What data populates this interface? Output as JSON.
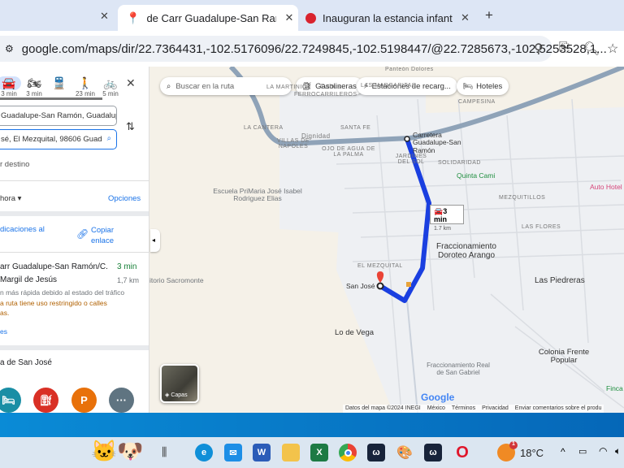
{
  "browser": {
    "tabs": [
      {
        "title": "de Carr Guadalupe-San Ramón"
      },
      {
        "title": "Inauguran la estancia infantil R"
      }
    ],
    "new_tab": "+",
    "url": "google.com/maps/dir/22.7364431,-102.5176096/22.7249845,-102.5198447/@22.7285673,-102.5253528,1..."
  },
  "panel": {
    "modes": [
      {
        "icon": "car-icon",
        "time": "3 min"
      },
      {
        "icon": "motorcycle-icon",
        "time": "3 min"
      },
      {
        "icon": "transit-icon",
        "time": ""
      },
      {
        "icon": "walk-icon",
        "time": "23 min"
      },
      {
        "icon": "bicycle-icon",
        "time": "5 min"
      }
    ],
    "origin": "Guadalupe-San Ramón, Guadalupe,",
    "destination": "sé, El Mezquital, 98606 Guad",
    "add_destination": "r destino",
    "depart": "hora",
    "options": "Opciones",
    "send": "dicaciones al",
    "copy_link": "Copiar enlace",
    "route": {
      "title": "arr Guadalupe-San Ramón/C.",
      "via": "Margil de Jesús",
      "time": "3 min",
      "distance": "1,7 km",
      "note": "n más rápida debido al estado del tráfico",
      "warning1": "a ruta tiene uso restringido o calles",
      "warning2": "as.",
      "details": "es"
    },
    "nearby": "a de San José",
    "categories": [
      {
        "icon": "hotel-icon",
        "color": "#1a8ea5"
      },
      {
        "icon": "gas-icon",
        "color": "#d93025"
      },
      {
        "icon": "parking-icon",
        "label": "P",
        "color": "#e8710a"
      },
      {
        "icon": "more-icon",
        "label": "···",
        "color": "#5f7481"
      }
    ]
  },
  "map": {
    "search_placeholder": "Buscar en la ruta",
    "chips": [
      "Gasolineras",
      "Estaciones de recarg...",
      "Hoteles"
    ],
    "labels": {
      "martinica": "LA MARTINICA",
      "cabus": "Cabus",
      "ferro": "FERROCARRILEROS",
      "margaritas": "LAS MARGARITAS",
      "campesina": "CAMPESINA",
      "cantera": "LA CANTERA",
      "santafe": "SANTA FE",
      "dignidad": "Dignidad",
      "villas": "VILLAS DE NAPOLES",
      "ojo": "OJO DE AGUA DE LA PALMA",
      "jardines": "JARDINES DEL SOL",
      "solidaridad": "SOLIDARIDAD",
      "mezquitillos": "MEZQUITILLOS",
      "flores": "LAS FLORES",
      "mezquital": "EL MEZQUITAL",
      "panteon": "Panteón Dolores"
    },
    "places": {
      "escuela": "Escuela PriMaria José Isabel Rodriguez Elias",
      "carretera": "Carretera Guadalupe-San Ramón",
      "quinta": "Quinta Cami",
      "auto": "Auto Hotel",
      "fracc": "Fraccionamiento Doroteo Arango",
      "piedreras": "Las Piedreras",
      "sacromonte": "itorio Sacromonte",
      "sanjose": "San José",
      "vega": "Lo de Vega",
      "real": "Fraccionamiento Real de San Gabriel",
      "colonia": "Colonia Frente Popular",
      "finca": "Finca"
    },
    "route_box": {
      "time": "3 min",
      "distance": "1.7 km"
    },
    "layers": "Capas",
    "logo": "Google",
    "footer": [
      "Datos del mapa ©2024 INEGI",
      "México",
      "Términos",
      "Privacidad",
      "Enviar comentarios sobre el produ"
    ],
    "route_color": "#1a3fe0"
  },
  "taskbar": {
    "temp": "18°C",
    "badge": "1"
  }
}
